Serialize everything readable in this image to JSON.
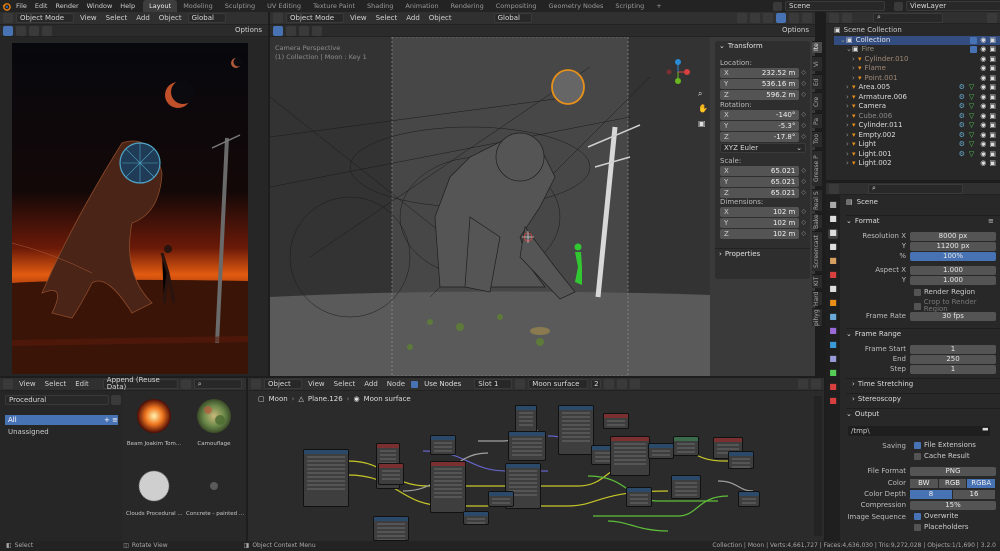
{
  "top_menu": [
    "File",
    "Edit",
    "Render",
    "Window",
    "Help"
  ],
  "workspaces": [
    "Layout",
    "Modeling",
    "Sculpting",
    "UV Editing",
    "Texture Paint",
    "Shading",
    "Animation",
    "Rendering",
    "Compositing",
    "Geometry Nodes",
    "Scripting"
  ],
  "workspace_add": "+",
  "scene": "Scene",
  "view_layer": "ViewLayer",
  "image_editor": {
    "mode": "Object Mode",
    "menus": [
      "View",
      "Select",
      "Add",
      "Object"
    ],
    "orientation": "Global",
    "options": "Options"
  },
  "viewport": {
    "mode": "Object Mode",
    "menus": [
      "View",
      "Select",
      "Add",
      "Object"
    ],
    "orientation": "Global",
    "options": "Options",
    "info_line1": "Camera Perspective",
    "info_line2": "(1) Collection | Moon : Key 1"
  },
  "transform_panel": {
    "title": "Transform",
    "location_label": "Location:",
    "location": [
      {
        "axis": "X",
        "value": "232.52 m"
      },
      {
        "axis": "Y",
        "value": "536.16 m"
      },
      {
        "axis": "Z",
        "value": "596.2 m"
      }
    ],
    "rotation_label": "Rotation:",
    "rotation": [
      {
        "axis": "X",
        "value": "-140°"
      },
      {
        "axis": "Y",
        "value": "-5.3°"
      },
      {
        "axis": "Z",
        "value": "-17.8°"
      }
    ],
    "rotation_mode": "XYZ Euler",
    "scale_label": "Scale:",
    "scale": [
      {
        "axis": "X",
        "value": "65.021"
      },
      {
        "axis": "Y",
        "value": "65.021"
      },
      {
        "axis": "Z",
        "value": "65.021"
      }
    ],
    "dimensions_label": "Dimensions:",
    "dimensions": [
      {
        "axis": "X",
        "value": "102 m"
      },
      {
        "axis": "Y",
        "value": "102 m"
      },
      {
        "axis": "Z",
        "value": "102 m"
      }
    ],
    "properties": "Properties"
  },
  "n_tabs": [
    "Ite",
    "Vi",
    "Ed",
    "Cre",
    "Pa",
    "Too",
    "Grease P",
    "Real S",
    "Bake",
    "Screencast",
    "KIT",
    "Hard",
    "pihyg"
  ],
  "outliner": {
    "root": "Scene Collection",
    "items": [
      {
        "label": "Collection",
        "depth": 1,
        "color": "#e0e0e0"
      },
      {
        "label": "Fire",
        "depth": 2,
        "color": "#9a8f7c"
      },
      {
        "label": "Cylinder.010",
        "depth": 3,
        "color": "#a08875"
      },
      {
        "label": "Flame",
        "depth": 3,
        "color": "#a08875"
      },
      {
        "label": "Point.001",
        "depth": 3,
        "color": "#a08875"
      },
      {
        "label": "Area.005",
        "depth": 2,
        "color": "#dcdcdc"
      },
      {
        "label": "Armature.006",
        "depth": 2,
        "color": "#dcdcdc"
      },
      {
        "label": "Camera",
        "depth": 2,
        "color": "#dcdcdc"
      },
      {
        "label": "Cube.006",
        "depth": 2,
        "color": "#8a8a8a"
      },
      {
        "label": "Cylinder.011",
        "depth": 2,
        "color": "#dcdcdc"
      },
      {
        "label": "Empty.002",
        "depth": 2,
        "color": "#dcdcdc"
      },
      {
        "label": "Light",
        "depth": 2,
        "color": "#dcdcdc"
      },
      {
        "label": "Light.001",
        "depth": 2,
        "color": "#dcdcdc"
      },
      {
        "label": "Light.002",
        "depth": 2,
        "color": "#dcdcdc"
      }
    ]
  },
  "properties": {
    "crumb": "Scene",
    "format_title": "Format",
    "resolution_x_label": "Resolution X",
    "resolution_x": "8000 px",
    "y_label": "Y",
    "resolution_y": "11200 px",
    "pct_label": "%",
    "resolution_pct": "100%",
    "aspect_x_label": "Aspect X",
    "aspect_x": "1.000",
    "aspect_y_label": "Y",
    "aspect_y": "1.000",
    "render_region": "Render Region",
    "crop_region": "Crop to Render Region",
    "frame_rate_label": "Frame Rate",
    "frame_rate": "30 fps",
    "frame_range_title": "Frame Range",
    "frame_start_label": "Frame Start",
    "frame_start": "1",
    "end_label": "End",
    "frame_end": "250",
    "step_label": "Step",
    "frame_step": "1",
    "time_stretching": "Time Stretching",
    "stereoscopy": "Stereoscopy",
    "output_title": "Output",
    "output_path": "/tmp\\",
    "saving_label": "Saving",
    "file_extensions": "File Extensions",
    "cache_result": "Cache Result",
    "file_format_label": "File Format",
    "file_format": "PNG",
    "color_label": "Color",
    "color_options": [
      "BW",
      "RGB",
      "RGBA"
    ],
    "color_depth_label": "Color Depth",
    "color_depth_options": [
      "8",
      "16"
    ],
    "compression_label": "Compression",
    "compression": "15%",
    "image_sequence_label": "Image Sequence",
    "overwrite": "Overwrite",
    "placeholders": "Placeholders"
  },
  "asset_browser": {
    "menus": [
      "View",
      "Select",
      "Edit"
    ],
    "library": "Append (Reuse Data)",
    "category": "Procedural",
    "catalogs": [
      {
        "label": "All",
        "selected": true
      },
      {
        "label": "Unassigned",
        "selected": false
      }
    ],
    "assets": [
      "Beam Joakim Tom...",
      "Camouflage",
      "Clouds Procedural ...",
      "Concrete - painted ..."
    ]
  },
  "node_editor": {
    "type": "Object",
    "menus": [
      "View",
      "Select",
      "Add",
      "Node"
    ],
    "use_nodes": "Use Nodes",
    "slot": "Slot 1",
    "material": "Moon surface",
    "users": "2",
    "breadcrumb": [
      "Moon",
      "Plane.126",
      "Moon surface"
    ]
  },
  "status": {
    "select": "Select",
    "rotate": "Rotate View",
    "context": "Object Context Menu",
    "stats": "Collection | Moon | Verts:4,661,727 | Faces:4,636,030 | Tris:9,272,028 | Objects:1/1,690 | 3.2.0"
  },
  "colors": {
    "accent": "#4772b3",
    "header": "#303030",
    "panel": "#282828"
  }
}
